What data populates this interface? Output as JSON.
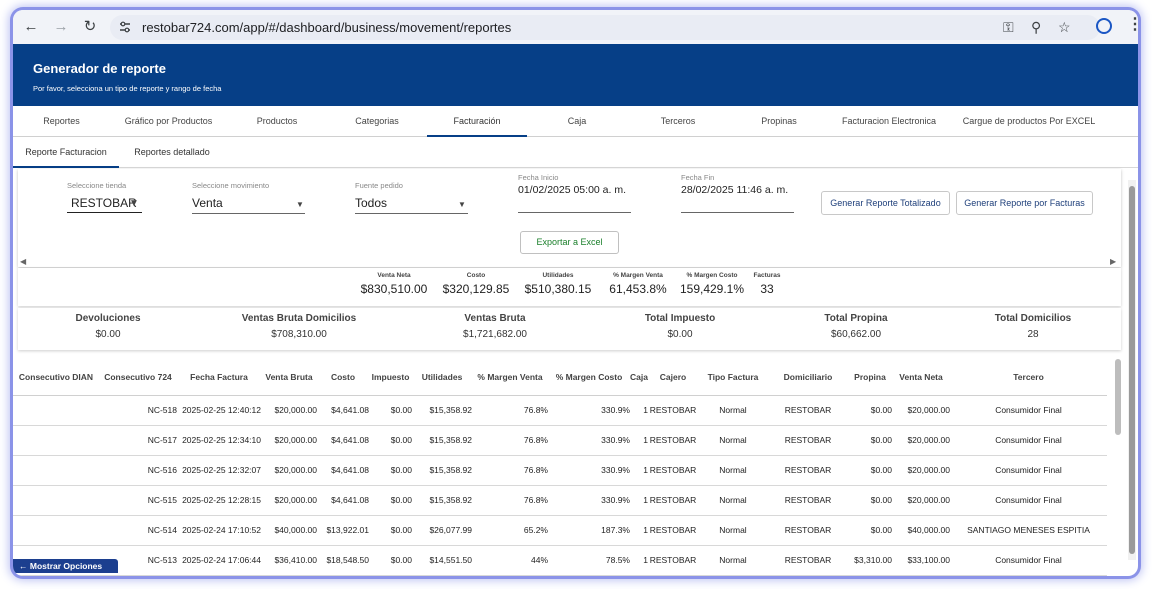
{
  "browser": {
    "url": "restobar724.com/app/#/dashboard/business/movement/reportes",
    "icons": [
      "back-icon",
      "forward-icon",
      "reload-icon",
      "site-settings-icon",
      "password-key-icon",
      "zoom-icon",
      "bookmark-star-icon",
      "profile-icon",
      "menu-dots-icon"
    ]
  },
  "header": {
    "title": "Generador de reporte",
    "subtitle": "Por favor, selecciona un tipo de reporte y rango de fecha",
    "bg": "#063f87"
  },
  "tabs": [
    "Reportes",
    "Gráfico por Productos",
    "Productos",
    "Categorias",
    "Facturación",
    "Caja",
    "Terceros",
    "Propinas",
    "Facturacion Electronica",
    "Cargue de productos Por EXCEL"
  ],
  "active_tab": "Facturación",
  "subtabs": [
    "Reporte Facturacion",
    "Reportes detallado"
  ],
  "filters": {
    "store_label": "Seleccione tienda",
    "store_value": "RESTOBAR",
    "movement_label": "Seleccione movimiento",
    "movement_value": "Venta",
    "source_label": "Fuente pedido",
    "source_value": "Todos",
    "start_label": "Fecha Inicio",
    "start_value": "01/02/2025 05:00 a. m.",
    "end_label": "Fecha Fin",
    "end_value": "28/02/2025 11:46 a. m.",
    "btn_total": "Generar Reporte Totalizado",
    "btn_facturas": "Generar Reporte por Facturas",
    "btn_excel": "Exportar a Excel"
  },
  "summary": {
    "venta_neta_label": "Venta Neta",
    "venta_neta": "$830,510.00",
    "costo_label": "Costo",
    "costo": "$320,129.85",
    "utilidades_label": "Utilidades",
    "utilidades": "$510,380.15",
    "margen_venta_label": "% Margen Venta",
    "margen_venta": "61,453.8%",
    "margen_costo_label": "% Margen Costo",
    "margen_costo": "159,429.1%",
    "facturas_label": "Facturas",
    "facturas": "33"
  },
  "summary2": {
    "devoluciones_label": "Devoluciones",
    "devoluciones": "$0.00",
    "vbd_label": "Ventas Bruta Domicilios",
    "vbd": "$708,310.00",
    "vb_label": "Ventas Bruta",
    "vb": "$1,721,682.00",
    "impuesto_label": "Total Impuesto",
    "impuesto": "$0.00",
    "propina_label": "Total Propina",
    "propina": "$60,662.00",
    "domicilios_label": "Total Domicilios",
    "domicilios": "28"
  },
  "table": {
    "columns": [
      "Consecutivo DIAN",
      "Consecutivo 724",
      "Fecha Factura",
      "Venta Bruta",
      "Costo",
      "Impuesto",
      "Utilidades",
      "% Margen Venta",
      "% Margen Costo",
      "Caja",
      "Cajero",
      "Tipo Factura",
      "Domiciliario",
      "Propina",
      "Venta Neta",
      "Tercero"
    ],
    "rows": [
      [
        "",
        "NC-518",
        "2025-02-25 12:40:12",
        "$20,000.00",
        "$4,641.08",
        "$0.00",
        "$15,358.92",
        "76.8%",
        "330.9%",
        "1",
        "RESTOBAR",
        "Normal",
        "RESTOBAR",
        "$0.00",
        "$20,000.00",
        "Consumidor Final"
      ],
      [
        "",
        "NC-517",
        "2025-02-25 12:34:10",
        "$20,000.00",
        "$4,641.08",
        "$0.00",
        "$15,358.92",
        "76.8%",
        "330.9%",
        "1",
        "RESTOBAR",
        "Normal",
        "RESTOBAR",
        "$0.00",
        "$20,000.00",
        "Consumidor Final"
      ],
      [
        "",
        "NC-516",
        "2025-02-25 12:32:07",
        "$20,000.00",
        "$4,641.08",
        "$0.00",
        "$15,358.92",
        "76.8%",
        "330.9%",
        "1",
        "RESTOBAR",
        "Normal",
        "RESTOBAR",
        "$0.00",
        "$20,000.00",
        "Consumidor Final"
      ],
      [
        "",
        "NC-515",
        "2025-02-25 12:28:15",
        "$20,000.00",
        "$4,641.08",
        "$0.00",
        "$15,358.92",
        "76.8%",
        "330.9%",
        "1",
        "RESTOBAR",
        "Normal",
        "RESTOBAR",
        "$0.00",
        "$20,000.00",
        "Consumidor Final"
      ],
      [
        "",
        "NC-514",
        "2025-02-24 17:10:52",
        "$40,000.00",
        "$13,922.01",
        "$0.00",
        "$26,077.99",
        "65.2%",
        "187.3%",
        "1",
        "RESTOBAR",
        "Normal",
        "RESTOBAR",
        "$0.00",
        "$40,000.00",
        "SANTIAGO MENESES ESPITIA"
      ],
      [
        "",
        "NC-513",
        "2025-02-24 17:06:44",
        "$36,410.00",
        "$18,548.50",
        "$0.00",
        "$14,551.50",
        "44%",
        "78.5%",
        "1",
        "RESTOBAR",
        "Normal",
        "RESTOBAR",
        "$3,310.00",
        "$33,100.00",
        "Consumidor Final"
      ]
    ]
  },
  "show_options": "Mostrar Opciones"
}
